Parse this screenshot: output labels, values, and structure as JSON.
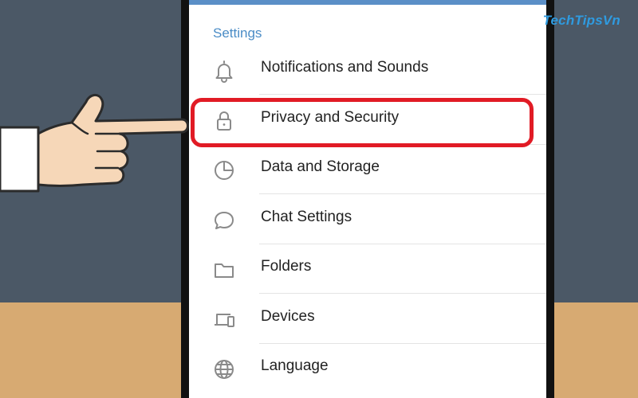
{
  "watermark": "TechTipsVn",
  "settings": {
    "title": "Settings",
    "items": [
      {
        "label": "Notifications and Sounds",
        "icon": "bell-icon"
      },
      {
        "label": "Privacy and Security",
        "icon": "lock-icon"
      },
      {
        "label": "Data and Storage",
        "icon": "pie-chart-icon"
      },
      {
        "label": "Chat Settings",
        "icon": "chat-bubble-icon"
      },
      {
        "label": "Folders",
        "icon": "folder-icon"
      },
      {
        "label": "Devices",
        "icon": "devices-icon"
      },
      {
        "label": "Language",
        "icon": "globe-icon"
      }
    ],
    "highlighted_item": "Privacy and Security"
  },
  "colors": {
    "accent": "#4a8cc6",
    "highlight": "#e11b25",
    "icon": "#8a8a8a",
    "watermark": "#2f9be0",
    "wall": "#4b5866",
    "desk": "#d7aa72"
  }
}
